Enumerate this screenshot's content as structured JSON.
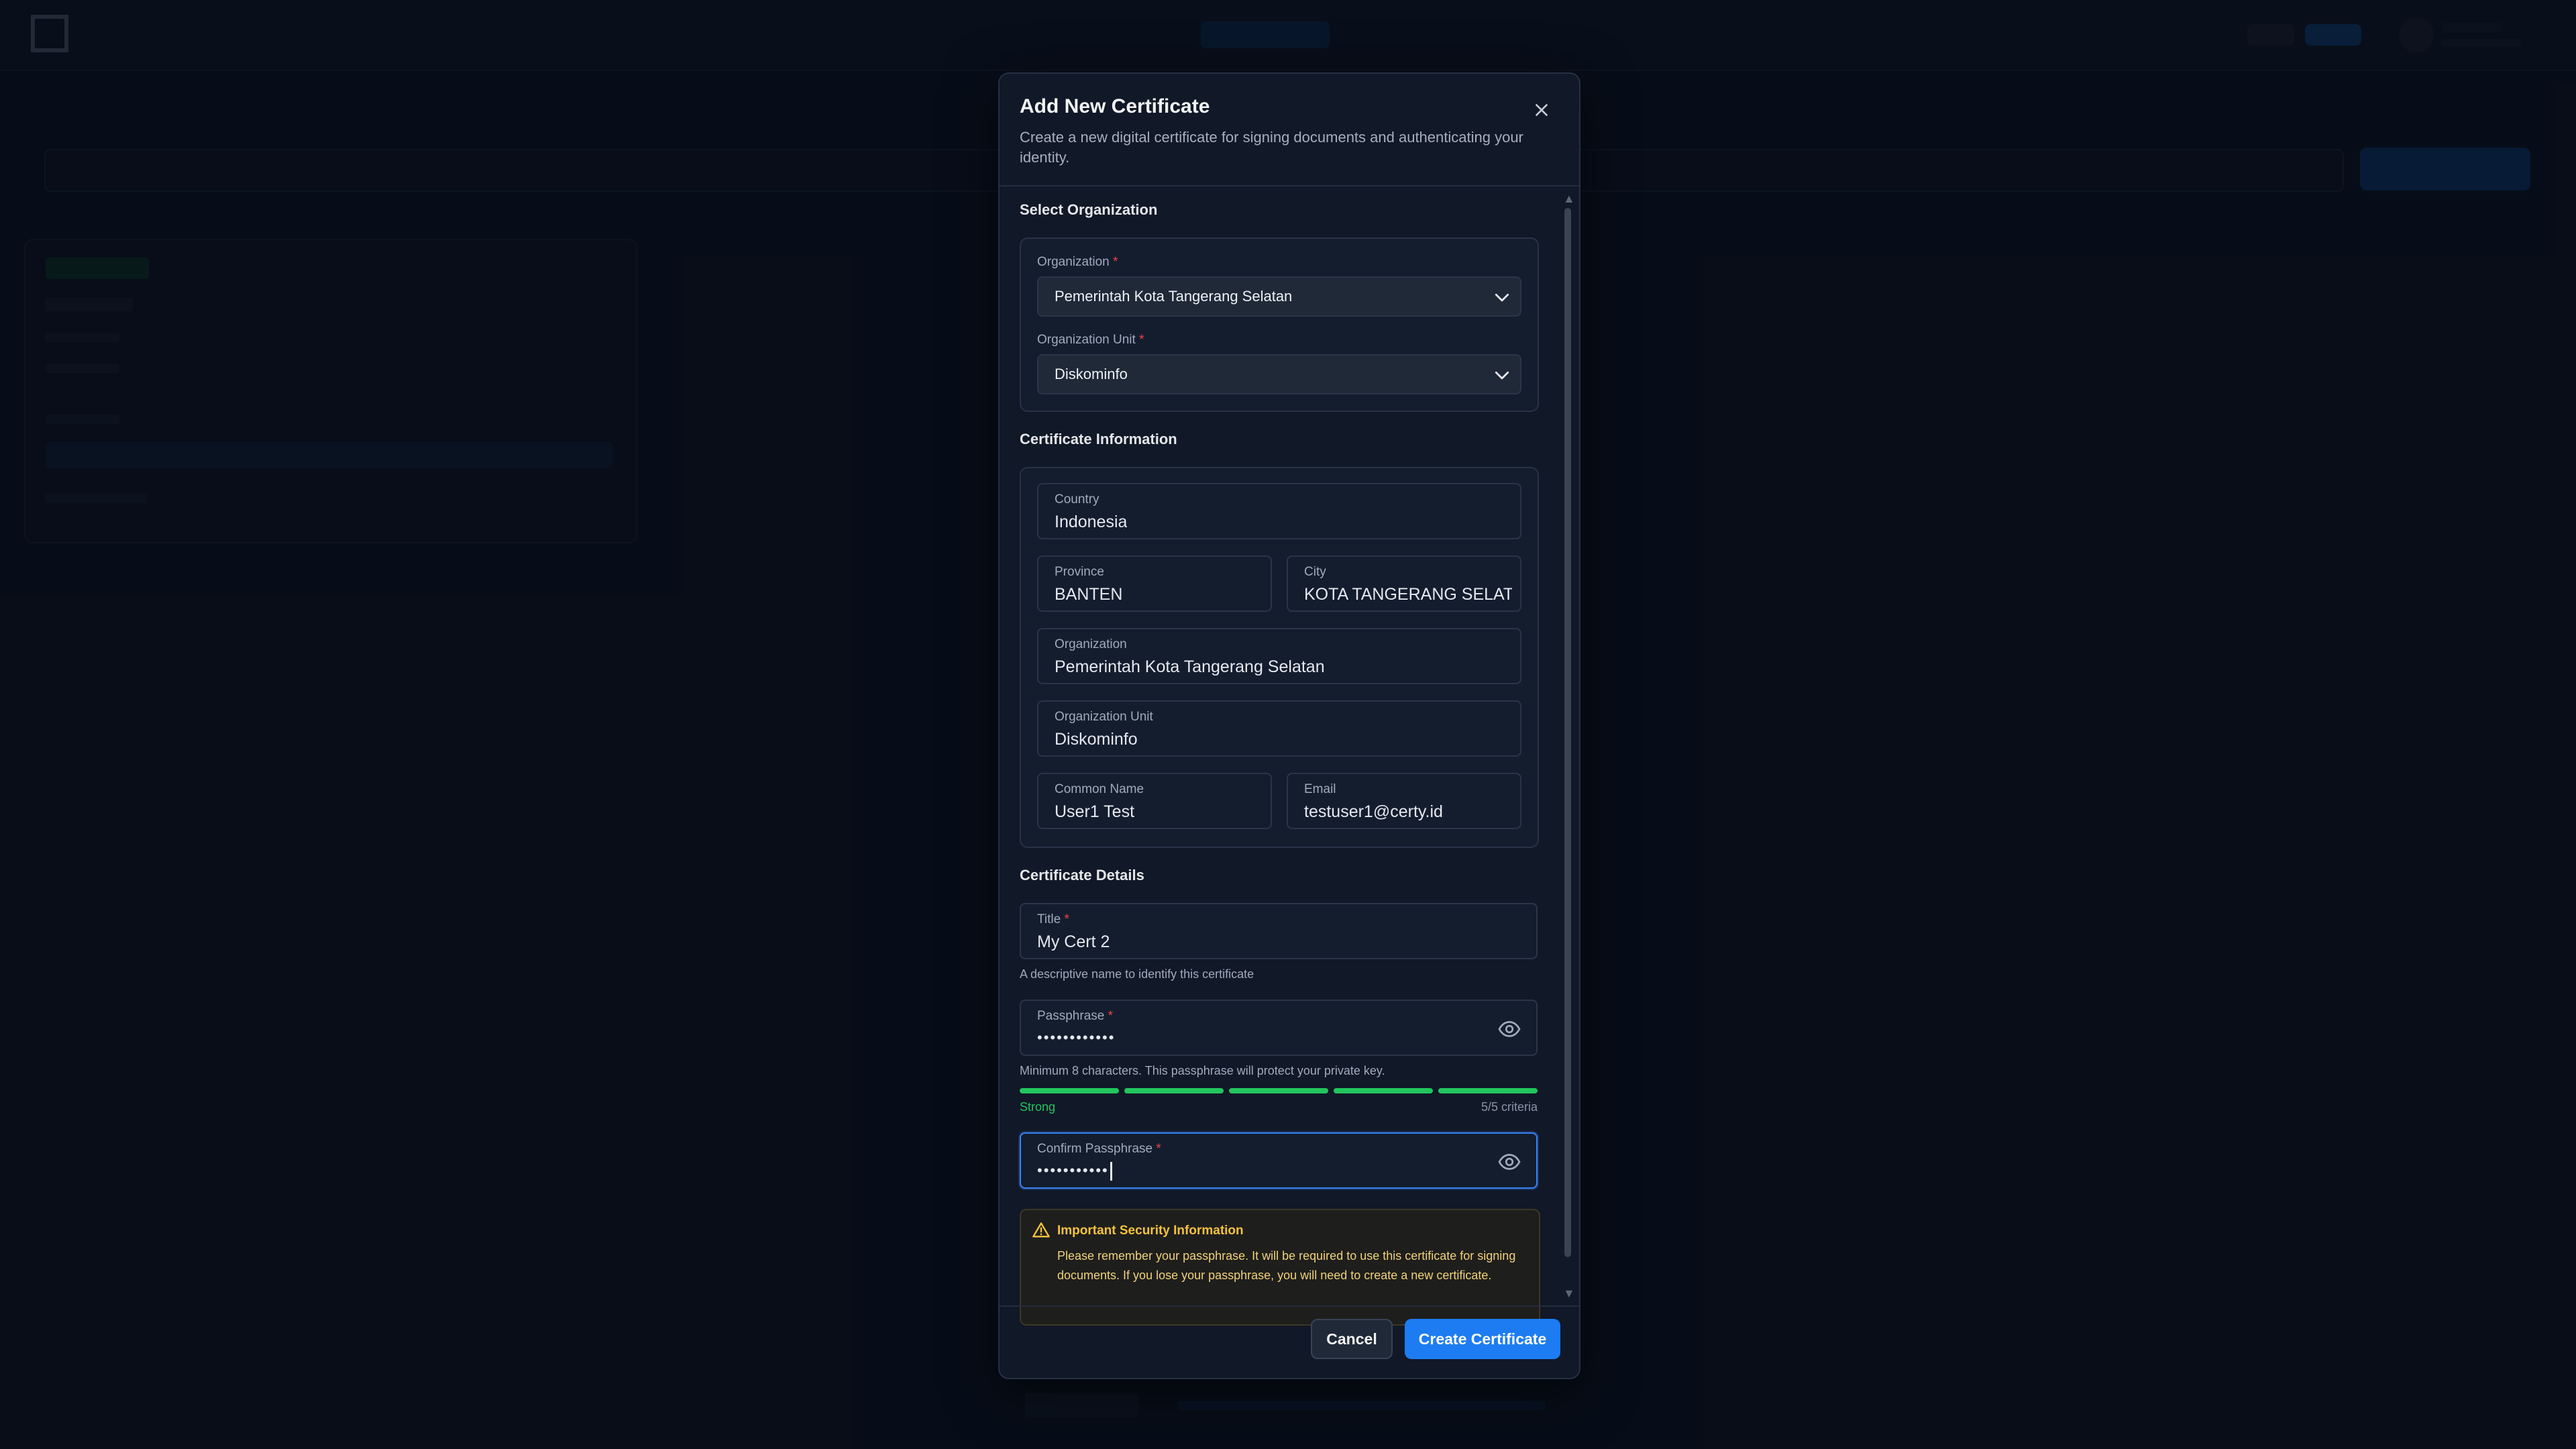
{
  "modal": {
    "title": "Add New Certificate",
    "description": "Create a new digital certificate for signing documents and authenticating your identity."
  },
  "select_org": {
    "section": "Select Organization",
    "organization_label": "Organization",
    "organization_value": "Pemerintah Kota Tangerang Selatan",
    "unit_label": "Organization Unit",
    "unit_value": "Diskominfo",
    "required_mark": "*"
  },
  "cert_info": {
    "section": "Certificate Information",
    "fields": {
      "country": {
        "label": "Country",
        "value": "Indonesia"
      },
      "province": {
        "label": "Province",
        "value": "BANTEN"
      },
      "city": {
        "label": "City",
        "value": "KOTA TANGERANG SELAT."
      },
      "organization": {
        "label": "Organization",
        "value": "Pemerintah Kota Tangerang Selatan"
      },
      "org_unit": {
        "label": "Organization Unit",
        "value": "Diskominfo"
      },
      "common_name": {
        "label": "Common Name",
        "value": "User1 Test"
      },
      "email": {
        "label": "Email",
        "value": "testuser1@certy.id"
      }
    }
  },
  "details": {
    "section": "Certificate Details",
    "title_label": "Title",
    "title_value": "My Cert 2",
    "title_helper": "A descriptive name to identify this certificate",
    "pass_label": "Passphrase",
    "pass_value": "••••••••••••",
    "pass_helper": "Minimum 8 characters. This passphrase will protect your private key.",
    "strength_label": "Strong",
    "criteria": "5/5 criteria",
    "confirm_label": "Confirm Passphrase",
    "confirm_value": "•••••••••••"
  },
  "warning": {
    "title": "Important Security Information",
    "body": "Please remember your passphrase. It will be required to use this certificate for signing documents. If you lose your passphrase, you will need to create a new certificate."
  },
  "buttons": {
    "cancel": "Cancel",
    "create": "Create Certificate"
  },
  "icons": {
    "close": "close-icon",
    "chevron": "chevron-down-icon",
    "eye": "eye-icon",
    "warning": "warning-triangle-icon"
  },
  "colors": {
    "primary": "#1d7cf2",
    "strength": "#22c55e",
    "warning": "#f5c33c",
    "required": "#ef4444"
  }
}
